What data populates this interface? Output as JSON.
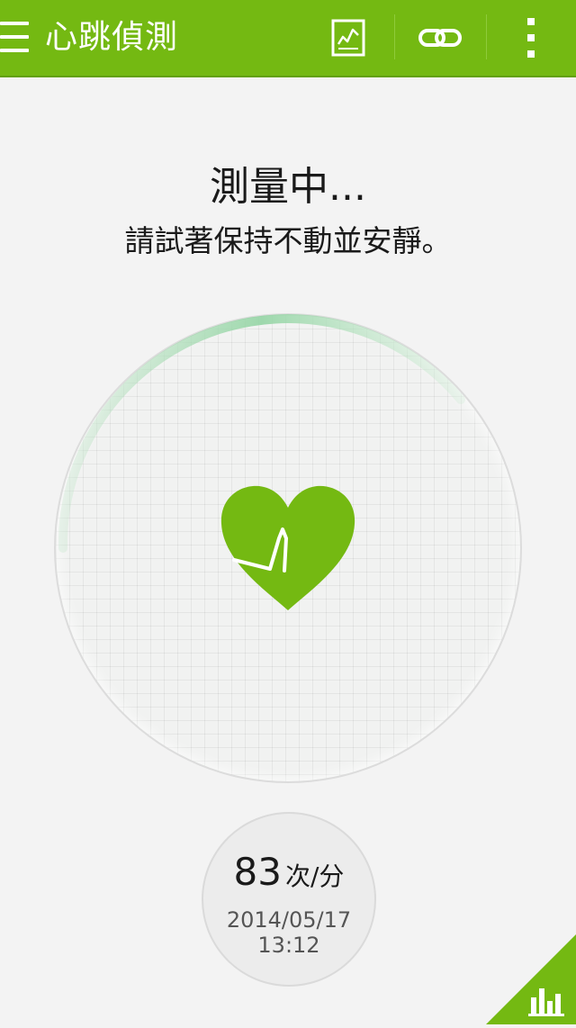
{
  "app": {
    "title": "心跳偵測",
    "icons": {
      "menu": "menu-icon",
      "report": "report-icon",
      "link": "link-icon",
      "more": "more-vertical-icon",
      "chart": "bar-chart-icon",
      "heart": "heart-icon"
    },
    "accent_color": "#74b912"
  },
  "status": {
    "title": "測量中...",
    "message": "請試著保持不動並安靜。"
  },
  "last_reading": {
    "bpm": "83",
    "unit": "次/分",
    "date": "2014/05/17",
    "time": "13:12"
  }
}
